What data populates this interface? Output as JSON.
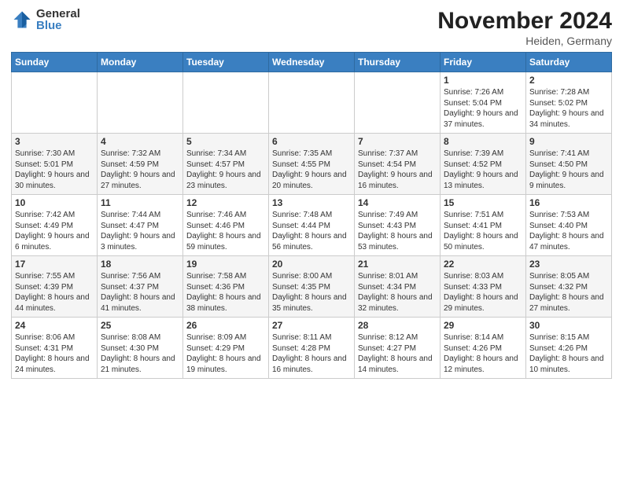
{
  "header": {
    "logo_general": "General",
    "logo_blue": "Blue",
    "month_title": "November 2024",
    "location": "Heiden, Germany"
  },
  "days_of_week": [
    "Sunday",
    "Monday",
    "Tuesday",
    "Wednesday",
    "Thursday",
    "Friday",
    "Saturday"
  ],
  "weeks": [
    [
      {
        "day": "",
        "info": ""
      },
      {
        "day": "",
        "info": ""
      },
      {
        "day": "",
        "info": ""
      },
      {
        "day": "",
        "info": ""
      },
      {
        "day": "",
        "info": ""
      },
      {
        "day": "1",
        "info": "Sunrise: 7:26 AM\nSunset: 5:04 PM\nDaylight: 9 hours and 37 minutes."
      },
      {
        "day": "2",
        "info": "Sunrise: 7:28 AM\nSunset: 5:02 PM\nDaylight: 9 hours and 34 minutes."
      }
    ],
    [
      {
        "day": "3",
        "info": "Sunrise: 7:30 AM\nSunset: 5:01 PM\nDaylight: 9 hours and 30 minutes."
      },
      {
        "day": "4",
        "info": "Sunrise: 7:32 AM\nSunset: 4:59 PM\nDaylight: 9 hours and 27 minutes."
      },
      {
        "day": "5",
        "info": "Sunrise: 7:34 AM\nSunset: 4:57 PM\nDaylight: 9 hours and 23 minutes."
      },
      {
        "day": "6",
        "info": "Sunrise: 7:35 AM\nSunset: 4:55 PM\nDaylight: 9 hours and 20 minutes."
      },
      {
        "day": "7",
        "info": "Sunrise: 7:37 AM\nSunset: 4:54 PM\nDaylight: 9 hours and 16 minutes."
      },
      {
        "day": "8",
        "info": "Sunrise: 7:39 AM\nSunset: 4:52 PM\nDaylight: 9 hours and 13 minutes."
      },
      {
        "day": "9",
        "info": "Sunrise: 7:41 AM\nSunset: 4:50 PM\nDaylight: 9 hours and 9 minutes."
      }
    ],
    [
      {
        "day": "10",
        "info": "Sunrise: 7:42 AM\nSunset: 4:49 PM\nDaylight: 9 hours and 6 minutes."
      },
      {
        "day": "11",
        "info": "Sunrise: 7:44 AM\nSunset: 4:47 PM\nDaylight: 9 hours and 3 minutes."
      },
      {
        "day": "12",
        "info": "Sunrise: 7:46 AM\nSunset: 4:46 PM\nDaylight: 8 hours and 59 minutes."
      },
      {
        "day": "13",
        "info": "Sunrise: 7:48 AM\nSunset: 4:44 PM\nDaylight: 8 hours and 56 minutes."
      },
      {
        "day": "14",
        "info": "Sunrise: 7:49 AM\nSunset: 4:43 PM\nDaylight: 8 hours and 53 minutes."
      },
      {
        "day": "15",
        "info": "Sunrise: 7:51 AM\nSunset: 4:41 PM\nDaylight: 8 hours and 50 minutes."
      },
      {
        "day": "16",
        "info": "Sunrise: 7:53 AM\nSunset: 4:40 PM\nDaylight: 8 hours and 47 minutes."
      }
    ],
    [
      {
        "day": "17",
        "info": "Sunrise: 7:55 AM\nSunset: 4:39 PM\nDaylight: 8 hours and 44 minutes."
      },
      {
        "day": "18",
        "info": "Sunrise: 7:56 AM\nSunset: 4:37 PM\nDaylight: 8 hours and 41 minutes."
      },
      {
        "day": "19",
        "info": "Sunrise: 7:58 AM\nSunset: 4:36 PM\nDaylight: 8 hours and 38 minutes."
      },
      {
        "day": "20",
        "info": "Sunrise: 8:00 AM\nSunset: 4:35 PM\nDaylight: 8 hours and 35 minutes."
      },
      {
        "day": "21",
        "info": "Sunrise: 8:01 AM\nSunset: 4:34 PM\nDaylight: 8 hours and 32 minutes."
      },
      {
        "day": "22",
        "info": "Sunrise: 8:03 AM\nSunset: 4:33 PM\nDaylight: 8 hours and 29 minutes."
      },
      {
        "day": "23",
        "info": "Sunrise: 8:05 AM\nSunset: 4:32 PM\nDaylight: 8 hours and 27 minutes."
      }
    ],
    [
      {
        "day": "24",
        "info": "Sunrise: 8:06 AM\nSunset: 4:31 PM\nDaylight: 8 hours and 24 minutes."
      },
      {
        "day": "25",
        "info": "Sunrise: 8:08 AM\nSunset: 4:30 PM\nDaylight: 8 hours and 21 minutes."
      },
      {
        "day": "26",
        "info": "Sunrise: 8:09 AM\nSunset: 4:29 PM\nDaylight: 8 hours and 19 minutes."
      },
      {
        "day": "27",
        "info": "Sunrise: 8:11 AM\nSunset: 4:28 PM\nDaylight: 8 hours and 16 minutes."
      },
      {
        "day": "28",
        "info": "Sunrise: 8:12 AM\nSunset: 4:27 PM\nDaylight: 8 hours and 14 minutes."
      },
      {
        "day": "29",
        "info": "Sunrise: 8:14 AM\nSunset: 4:26 PM\nDaylight: 8 hours and 12 minutes."
      },
      {
        "day": "30",
        "info": "Sunrise: 8:15 AM\nSunset: 4:26 PM\nDaylight: 8 hours and 10 minutes."
      }
    ]
  ]
}
